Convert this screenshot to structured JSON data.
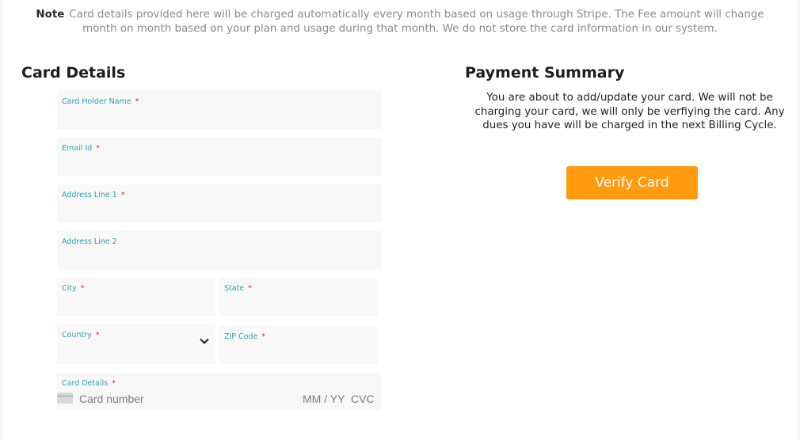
{
  "note": {
    "label": "Note",
    "text": "Card details provided here will be charged automatically every month based on usage through Stripe. The Fee amount will change month on month based on your plan and usage during that month. We do not store the card information in our system."
  },
  "card_details": {
    "title": "Card Details",
    "fields": {
      "card_holder_name": {
        "label": "Card Holder Name",
        "required": "*"
      },
      "email": {
        "label": "Email Id",
        "required": "*"
      },
      "address1": {
        "label": "Address Line 1",
        "required": "*"
      },
      "address2": {
        "label": "Address Line 2"
      },
      "city": {
        "label": "City",
        "required": "*"
      },
      "state": {
        "label": "State",
        "required": "*"
      },
      "country": {
        "label": "Country",
        "required": "*"
      },
      "zip": {
        "label": "ZIP Code",
        "required": "*"
      },
      "card": {
        "label": "Card Details",
        "required": "*"
      }
    },
    "card_input": {
      "number_placeholder": "Card number",
      "expiry_placeholder": "MM / YY",
      "cvc_placeholder": "CVC"
    }
  },
  "payment_summary": {
    "title": "Payment Summary",
    "text": "You are about to add/update your card. We will not be charging your card, we will only be verfiying the card. Any dues you have will be charged in the next Billing Cycle.",
    "verify_button": "Verify Card"
  },
  "colors": {
    "accent": "#ff9b0d",
    "label": "#27a3b6",
    "required": "#e0223a"
  },
  "icons": {
    "dropdown": "chevron-down-icon",
    "card": "credit-card-icon"
  }
}
